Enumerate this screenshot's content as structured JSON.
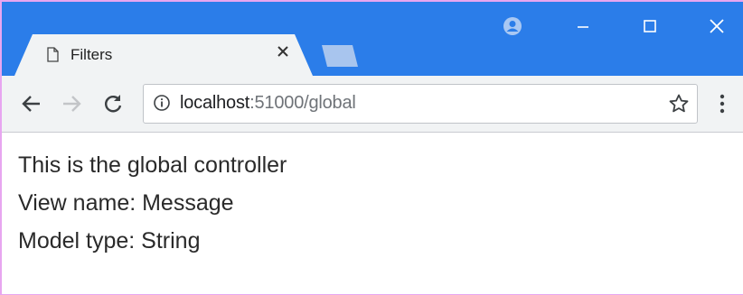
{
  "browser": {
    "tab": {
      "title": "Filters",
      "icon": "document-icon"
    },
    "window_controls": [
      "profile-icon",
      "minimize-icon",
      "maximize-icon",
      "close-icon"
    ],
    "address_bar": {
      "host": "localhost",
      "rest": ":51000/global"
    },
    "nav_icons": [
      "back-arrow-icon",
      "forward-arrow-icon",
      "reload-icon"
    ],
    "colors": {
      "titlebar": "#2b7de9",
      "toolbar": "#f1f3f4",
      "inactive_tab": "#a8c5ee"
    }
  },
  "page": {
    "lines": [
      "This is the global controller",
      "View name: Message",
      "Model type: String"
    ]
  }
}
